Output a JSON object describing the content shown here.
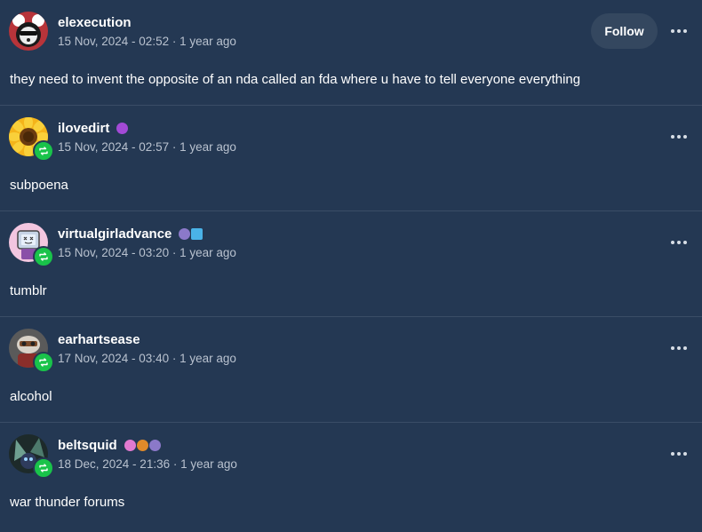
{
  "posts": [
    {
      "username": "elexecution",
      "meta": "15 Nov, 2024 - 02:52 · 1 year ago",
      "content": "they need to invent the opposite of an nda called an fda where u have to tell everyone everything",
      "follow_label": "Follow",
      "avatar_icon": "panda-avatar",
      "badges": []
    },
    {
      "username": "ilovedirt",
      "meta": "15 Nov, 2024 - 02:57 · 1 year ago",
      "content": "subpoena",
      "avatar_icon": "sunflower-avatar",
      "badges": [
        "skull-badge"
      ]
    },
    {
      "username": "virtualgirladvance",
      "meta": "15 Nov, 2024 - 03:20 · 1 year ago",
      "content": "tumblr",
      "avatar_icon": "robot-avatar",
      "badges": [
        "ghost-badge",
        "flag-badge"
      ]
    },
    {
      "username": "earhartsease",
      "meta": "17 Nov, 2024 - 03:40 · 1 year ago",
      "content": "alcohol",
      "avatar_icon": "pilot-avatar",
      "badges": []
    },
    {
      "username": "beltsquid",
      "meta": "18 Dec, 2024 - 21:36 · 1 year ago",
      "content": "war thunder forums",
      "avatar_icon": "squid-avatar",
      "badges": [
        "flower-badge",
        "paw-badge",
        "ghost-badge"
      ]
    }
  ],
  "colors": {
    "background": "#243853",
    "divider": "#3a4d66",
    "follow_button": "#34475f",
    "reblog_green": "#19c34a",
    "meta_text": "#b9c2cf"
  }
}
